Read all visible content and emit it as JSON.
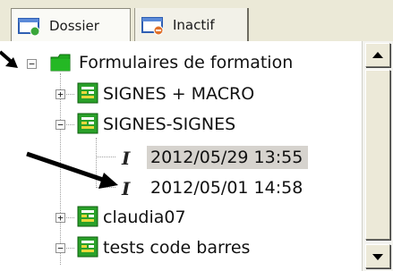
{
  "tabs": [
    {
      "label": "Dossier",
      "icon": "window-icon",
      "active": true
    },
    {
      "label": "Inactif",
      "icon": "window-error-icon",
      "active": false
    }
  ],
  "tree": {
    "root": {
      "label": "Formulaires de formation",
      "icon": "folder-icon",
      "expanded": true
    },
    "items": [
      {
        "label": "SIGNES + MACRO",
        "icon": "form-icon",
        "expander": "+"
      },
      {
        "label": "SIGNES-SIGNES",
        "icon": "form-icon",
        "expander": "−",
        "children": [
          {
            "label": "2012/05/29 13:55",
            "icon": "italic-i-icon",
            "selected": true
          },
          {
            "label": "2012/05/01 14:58",
            "icon": "italic-i-icon",
            "selected": false
          }
        ]
      },
      {
        "label": "claudia07",
        "icon": "form-icon",
        "expander": "+"
      },
      {
        "label": "tests code barres",
        "icon": "form-icon",
        "expander": "−"
      }
    ]
  },
  "colors": {
    "tab_strip_bg": "#ebe9d7",
    "selection_bg": "#d6d3ce",
    "folder_green": "#1fa81f",
    "form_green": "#2aa02a",
    "annotation_arrow": "#000000"
  },
  "glyphs": {
    "root_expander": "−",
    "italic_i": "I",
    "scroll_up": "▲",
    "scroll_down": "▼"
  }
}
